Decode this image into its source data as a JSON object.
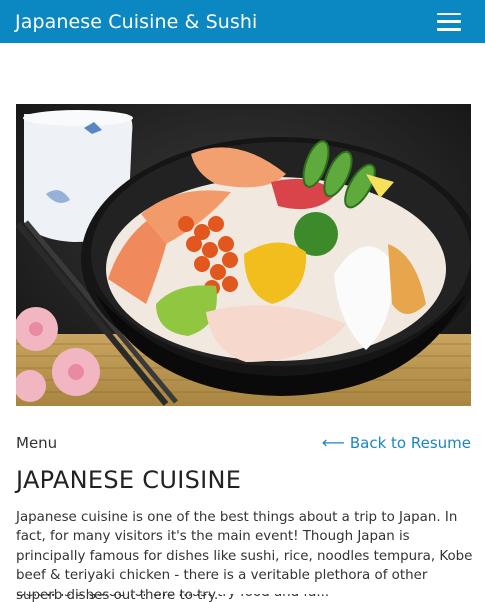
{
  "header": {
    "title": "Japanese Cuisine & Sushi",
    "menu_icon": "hamburger-menu-icon",
    "background_color": "#0b87c1"
  },
  "hero": {
    "alt": "Japanese cuisine photo"
  },
  "nav": {
    "menu_label": "Menu",
    "back_label": "Back to Resume",
    "back_icon": "arrow-left-icon",
    "link_color": "#1a86c4"
  },
  "content": {
    "heading": "JAPANESE CUISINE",
    "paragraph": "Japanese cuisine is one of the best things about a trip to Japan. In fact, for many visitors it's the main event! Though Japan is principally famous for dishes like sushi, rice, noodles tempura, Kobe beef & teriyaki chicken - there is a veritable plethora of other superb dishes out there to try.",
    "next_paragraph_partial": "Below is a guide for the must-try food and fa..."
  }
}
